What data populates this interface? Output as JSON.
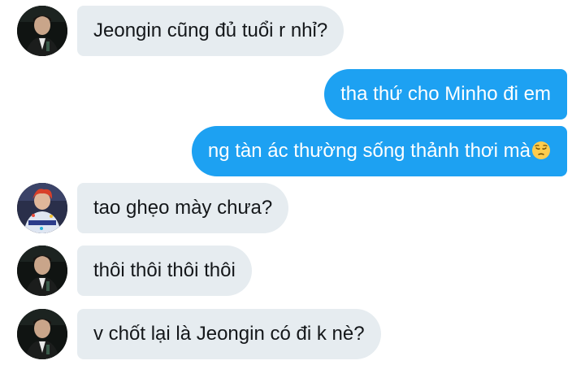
{
  "conversation": {
    "messages": [
      {
        "sender": "other",
        "avatar": "avatar-dark",
        "text": "Jeongin cũng đủ tuổi r nhỉ?"
      },
      {
        "sender": "self",
        "text": "tha thứ cho Minho đi em"
      },
      {
        "sender": "self",
        "text": "ng tàn ác thường sống thảnh thơi mà",
        "emoji": "pensive-face"
      },
      {
        "sender": "other",
        "avatar": "avatar-colorful",
        "text": "tao ghẹo mày chưa?"
      },
      {
        "sender": "other",
        "avatar": "avatar-dark",
        "text": "thôi thôi thôi thôi"
      },
      {
        "sender": "other",
        "avatar": "avatar-dark",
        "text": "v chốt lại là Jeongin có đi k nè?"
      }
    ]
  },
  "colors": {
    "incoming_bubble": "#e6ecf0",
    "outgoing_bubble": "#1da1f2",
    "incoming_text": "#14171a",
    "outgoing_text": "#ffffff"
  }
}
